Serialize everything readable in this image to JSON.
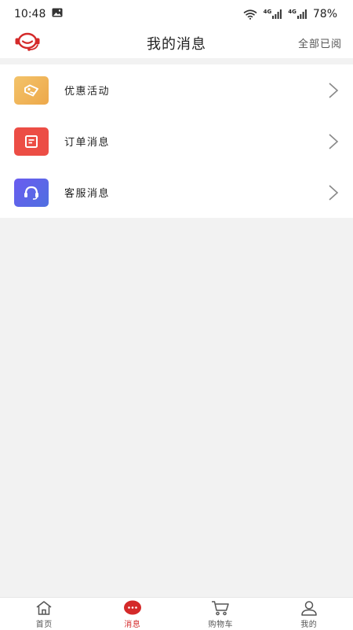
{
  "status_bar": {
    "time": "10:48",
    "left_icons": [
      "image-icon"
    ],
    "network_labels": [
      "4G",
      "4G"
    ],
    "battery": "78%"
  },
  "header": {
    "title": "我的消息",
    "action_label": "全部已阅",
    "logo_icon": "headset-logo-icon"
  },
  "messages": {
    "items": [
      {
        "label": "优惠活动",
        "icon": "tag-icon",
        "color": "#f0b14e"
      },
      {
        "label": "订单消息",
        "icon": "document-icon",
        "color": "#ec4d45"
      },
      {
        "label": "客服消息",
        "icon": "headset-icon",
        "color": "#5a5fe0"
      }
    ]
  },
  "bottom_nav": {
    "items": [
      {
        "label": "首页",
        "icon": "home-icon"
      },
      {
        "label": "消息",
        "icon": "chat-bubble-icon",
        "active": true
      },
      {
        "label": "购物车",
        "icon": "cart-icon"
      },
      {
        "label": "我的",
        "icon": "user-icon"
      }
    ]
  },
  "colors": {
    "accent": "#d42a2a",
    "background": "#f2f2f2"
  }
}
